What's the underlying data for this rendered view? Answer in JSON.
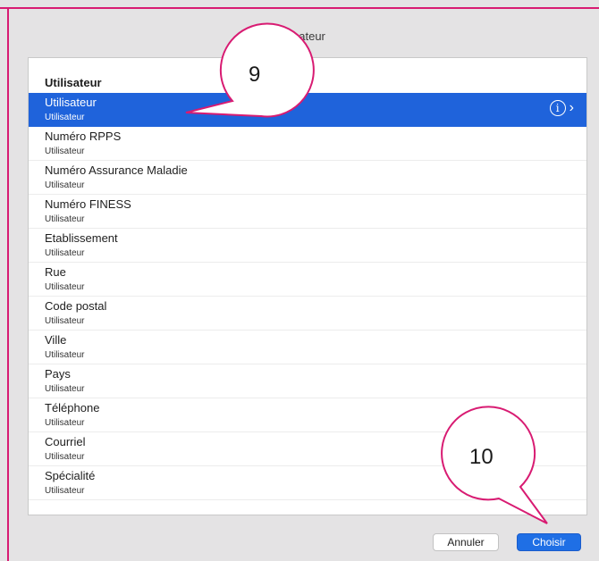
{
  "window": {
    "title": "Utilisateur"
  },
  "list": {
    "header": "Utilisateur",
    "rows": [
      {
        "main": "Utilisateur",
        "sub": "Utilisateur"
      },
      {
        "main": "Numéro RPPS",
        "sub": "Utilisateur"
      },
      {
        "main": "Numéro Assurance Maladie",
        "sub": "Utilisateur"
      },
      {
        "main": "Numéro FINESS",
        "sub": "Utilisateur"
      },
      {
        "main": "Etablissement",
        "sub": "Utilisateur"
      },
      {
        "main": "Rue",
        "sub": "Utilisateur"
      },
      {
        "main": "Code postal",
        "sub": "Utilisateur"
      },
      {
        "main": "Ville",
        "sub": "Utilisateur"
      },
      {
        "main": "Pays",
        "sub": "Utilisateur"
      },
      {
        "main": "Téléphone",
        "sub": "Utilisateur"
      },
      {
        "main": "Courriel",
        "sub": "Utilisateur"
      },
      {
        "main": "Spécialité",
        "sub": "Utilisateur"
      }
    ],
    "selected_index": 0
  },
  "info_icon_glyph": "i",
  "chevron_glyph": "›",
  "buttons": {
    "cancel": "Annuler",
    "choose": "Choisir"
  },
  "callouts": {
    "first": "9",
    "second": "10"
  },
  "colors": {
    "selection": "#1f63db",
    "primary_button": "#1f6fe5",
    "callout_stroke": "#d81b72"
  }
}
